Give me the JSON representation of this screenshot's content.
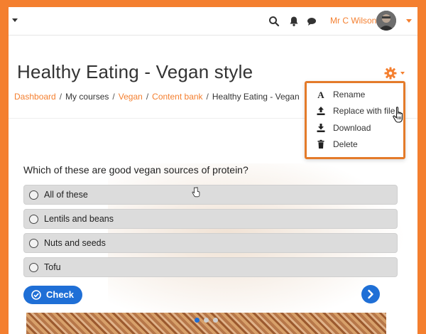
{
  "user": {
    "name": "Mr C Wilson"
  },
  "page": {
    "title": "Healthy Eating - Vegan style"
  },
  "breadcrumb": {
    "items": [
      {
        "label": "Dashboard",
        "link": true
      },
      {
        "label": "My courses",
        "link": false
      },
      {
        "label": "Vegan",
        "link": true
      },
      {
        "label": "Content bank",
        "link": true
      },
      {
        "label": "Healthy Eating - Vegan",
        "link": false
      }
    ],
    "separator": "/"
  },
  "menu": {
    "items": [
      {
        "label": "Rename",
        "icon": "rename-icon"
      },
      {
        "label": "Replace with file",
        "icon": "upload-icon"
      },
      {
        "label": "Download",
        "icon": "download-icon"
      },
      {
        "label": "Delete",
        "icon": "trash-icon"
      }
    ]
  },
  "quiz": {
    "question": "Which of these are good vegan sources of protein?",
    "answers": [
      "All of these",
      "Lentils and beans",
      "Nuts and seeds",
      "Tofu"
    ],
    "check_label": "Check"
  },
  "colors": {
    "accent": "#f47f2f",
    "button": "#1f6fd6",
    "answer_bg": "#dcdcdc"
  }
}
